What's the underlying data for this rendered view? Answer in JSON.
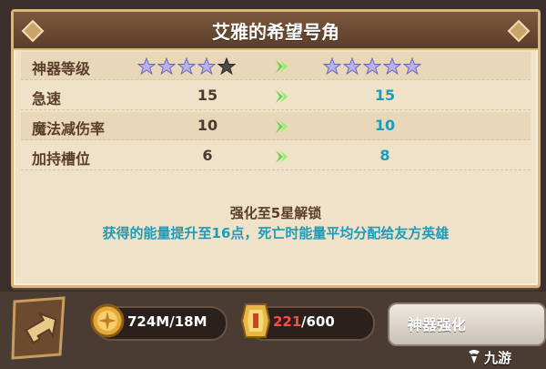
{
  "title": "艾雅的希望号角",
  "rows": [
    {
      "label": "神器等级",
      "stars_left_filled": 4,
      "stars_left_total": 5,
      "stars_right_filled": 5,
      "stars_right_total": 5
    },
    {
      "label": "急速",
      "left": "15",
      "right": "15"
    },
    {
      "label": "魔法减伤率",
      "left": "10",
      "right": "10"
    },
    {
      "label": "加持槽位",
      "left": "6",
      "right": "8"
    }
  ],
  "unlock": {
    "title": "强化至5星解锁",
    "desc": "获得的能量提升至16点，死亡时能量平均分配给友方英雄"
  },
  "resources": {
    "gold": "724M/18M",
    "shard_current": "221",
    "shard_max": "/600"
  },
  "upgrade_button": "神器强化",
  "watermark": "九游",
  "colors": {
    "accent_cyan": "#1f9bb7",
    "title_brown": "#5b3e2a",
    "panel_bg": "#efe2c8",
    "arrow_green": "#66d24a",
    "star_purple": "#b8b0e8"
  },
  "icons": {
    "arrow": "green-arrow-right-icon",
    "gold": "gold-coin-icon",
    "shard": "artifact-shard-icon",
    "back": "back-arrow-icon"
  }
}
